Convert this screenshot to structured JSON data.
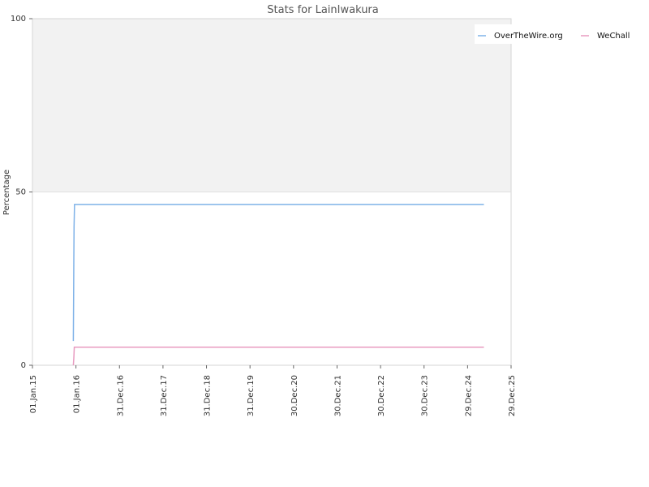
{
  "chart_data": {
    "type": "line",
    "title": "Stats for LainIwakura",
    "xlabel": "",
    "ylabel": "Percentage",
    "ylim": [
      0,
      100
    ],
    "y_ticks": [
      "0",
      "50",
      "100"
    ],
    "x_ticks": [
      "01.Jan.15",
      "01.Jan.16",
      "31.Dec.16",
      "31.Dec.17",
      "31.Dec.18",
      "31.Dec.19",
      "30.Dec.20",
      "30.Dec.21",
      "30.Dec.22",
      "30.Dec.23",
      "29.Dec.24",
      "29.Dec.25"
    ],
    "xlim": [
      "2015-01-01",
      "2025-12-29"
    ],
    "grid": true,
    "legend_position": "top-right",
    "background_upper": "#f2f2f2",
    "series": [
      {
        "name": "OverTheWire.org",
        "color": "#7fb2e8",
        "points": [
          {
            "x": "2015-12-10",
            "y": 7
          },
          {
            "x": "2015-12-12",
            "y": 18
          },
          {
            "x": "2015-12-14",
            "y": 30
          },
          {
            "x": "2015-12-16",
            "y": 40
          },
          {
            "x": "2015-12-20",
            "y": 46.4
          },
          {
            "x": "2025-05-15",
            "y": 46.4
          }
        ]
      },
      {
        "name": "WeChall",
        "color": "#e89bc0",
        "points": [
          {
            "x": "2015-12-10",
            "y": 0
          },
          {
            "x": "2015-12-14",
            "y": 2
          },
          {
            "x": "2015-12-18",
            "y": 5.2
          },
          {
            "x": "2025-05-15",
            "y": 5.2
          }
        ]
      }
    ]
  }
}
